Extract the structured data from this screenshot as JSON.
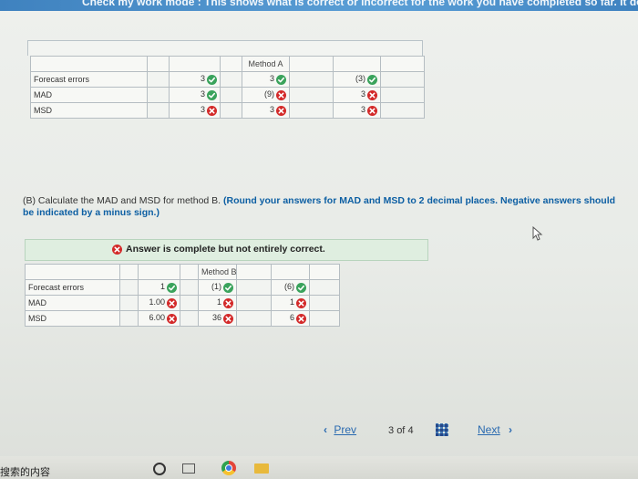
{
  "banner": {
    "text": "Check my work mode : This shows what is correct or incorrect for the work you have completed so far. It does not indicate"
  },
  "method_a": {
    "header": "Method A",
    "rows": [
      {
        "label": "Forecast errors",
        "cells": [
          {
            "text": "3",
            "mark": "check"
          },
          {
            "text": "3",
            "mark": "check"
          },
          {
            "text": "(3)",
            "mark": "check"
          }
        ]
      },
      {
        "label": "MAD",
        "cells": [
          {
            "text": "3",
            "mark": "check"
          },
          {
            "text": "(9)",
            "mark": "cross"
          },
          {
            "text": "3",
            "mark": "cross"
          }
        ]
      },
      {
        "label": "MSD",
        "cells": [
          {
            "text": "3",
            "mark": "cross"
          },
          {
            "text": "3",
            "mark": "cross"
          },
          {
            "text": "3",
            "mark": "cross"
          }
        ]
      }
    ]
  },
  "question": {
    "part": "(B) Calculate the MAD and MSD for method B.",
    "note": "(Round your answers for MAD and MSD to 2 decimal places. Negative answers should be indicated by a minus sign.)"
  },
  "status": {
    "text": "Answer is complete but not entirely correct."
  },
  "method_b": {
    "header": "Method B",
    "rows": [
      {
        "label": "Forecast errors",
        "cells": [
          {
            "text": "1",
            "mark": "check"
          },
          {
            "text": "(1)",
            "mark": "check"
          },
          {
            "text": "(6)",
            "mark": "check"
          }
        ]
      },
      {
        "label": "MAD",
        "cells": [
          {
            "text": "1.00",
            "mark": "cross"
          },
          {
            "text": "1",
            "mark": "cross"
          },
          {
            "text": "1",
            "mark": "cross"
          }
        ]
      },
      {
        "label": "MSD",
        "cells": [
          {
            "text": "6.00",
            "mark": "cross"
          },
          {
            "text": "36",
            "mark": "cross"
          },
          {
            "text": "6",
            "mark": "cross"
          }
        ]
      }
    ]
  },
  "pagination": {
    "prev": "Prev",
    "current": "3",
    "of": "of",
    "total": "4",
    "next": "Next"
  },
  "taskbar": {
    "search_text": "搜索的内容"
  },
  "colors": {
    "check": "#3aa35c",
    "cross": "#d32929",
    "link": "#2a6ab0",
    "banner": "#4a8fcb",
    "status_bg": "#dfeee0"
  }
}
